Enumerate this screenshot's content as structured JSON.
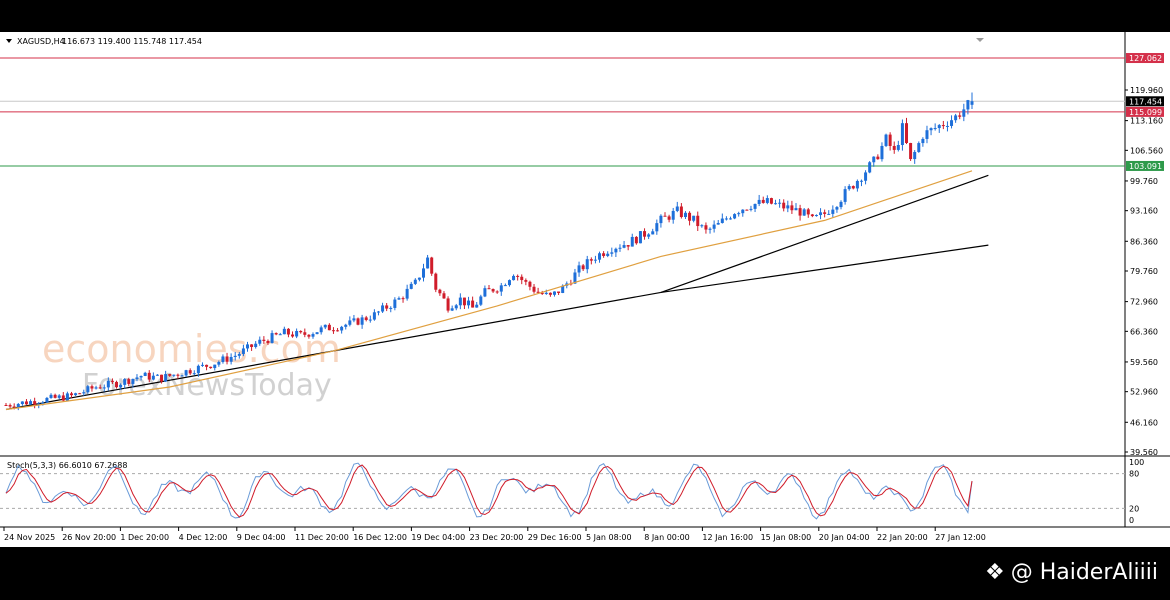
{
  "header": {
    "symbol": "XAGUSD,H4",
    "ohlc": "116.673 119.400 115.748 117.454",
    "dropdown_icon": "triangle-down-icon"
  },
  "watermark": {
    "line1": "economies.com",
    "line2": "ForexNewsToday",
    "handle": "@ HaiderAliiii",
    "handle_icon": "diamond-logo-icon"
  },
  "colors": {
    "bull": "#1e6fd9",
    "bear": "#d01c2a",
    "resistance": "#d4304a",
    "support": "#2e9a4a",
    "ma": "#e0a040",
    "trend": "#000000",
    "stoch_main": "#6a9bd8",
    "stoch_signal": "#d01c2a"
  },
  "chart_data": {
    "type": "candlestick",
    "symbol": "XAGUSD",
    "timeframe": "H4",
    "open": 116.673,
    "high": 119.4,
    "low": 115.748,
    "close": 117.454,
    "ylim": [
      39.56,
      130.5
    ],
    "price_ticks": [
      "119.960",
      "113.160",
      "106.560",
      "99.760",
      "93.160",
      "86.360",
      "79.760",
      "72.960",
      "66.360",
      "59.560",
      "52.960",
      "46.160",
      "39.560"
    ],
    "price_tick_values": [
      119.96,
      113.16,
      106.56,
      99.76,
      93.16,
      86.36,
      79.76,
      72.96,
      66.36,
      59.56,
      52.96,
      46.16,
      39.56
    ],
    "time_ticks": [
      "24 Nov 2025",
      "26 Nov 20:00",
      "1 Dec 20:00",
      "4 Dec 12:00",
      "9 Dec 04:00",
      "11 Dec 20:00",
      "16 Dec 12:00",
      "19 Dec 04:00",
      "23 Dec 20:00",
      "29 Dec 16:00",
      "5 Jan 08:00",
      "8 Jan 00:00",
      "12 Jan 16:00",
      "15 Jan 08:00",
      "20 Jan 04:00",
      "22 Jan 20:00",
      "27 Jan 12:00"
    ],
    "hlines": [
      {
        "name": "resistance-1",
        "value": 127.062,
        "label": "127.062",
        "color": "#d4304a"
      },
      {
        "name": "resistance-2",
        "value": 115.099,
        "label": "115.099",
        "color": "#d4304a"
      },
      {
        "name": "current-price",
        "value": 117.454,
        "label": "117.454",
        "color": "#000000"
      },
      {
        "name": "support-1",
        "value": 103.091,
        "label": "103.091",
        "color": "#2e9a4a"
      }
    ],
    "close_path": [
      [
        0,
        50.0
      ],
      [
        8,
        51.0
      ],
      [
        16,
        52.0
      ],
      [
        22,
        54.0
      ],
      [
        28,
        55.0
      ],
      [
        33,
        56.5
      ],
      [
        38,
        56.0
      ],
      [
        44,
        57.5
      ],
      [
        50,
        59.0
      ],
      [
        56,
        61.0
      ],
      [
        62,
        64.0
      ],
      [
        68,
        66.0
      ],
      [
        72,
        65.5
      ],
      [
        78,
        67.0
      ],
      [
        84,
        68.0
      ],
      [
        90,
        70.0
      ],
      [
        96,
        73.5
      ],
      [
        100,
        77.0
      ],
      [
        103,
        82.5
      ],
      [
        105,
        76.0
      ],
      [
        108,
        72.0
      ],
      [
        111,
        73.5
      ],
      [
        114,
        71.5
      ],
      [
        117,
        75.0
      ],
      [
        121,
        76.5
      ],
      [
        124,
        79.5
      ],
      [
        127,
        77.0
      ],
      [
        130,
        75.0
      ],
      [
        133,
        74.0
      ],
      [
        136,
        76.0
      ],
      [
        140,
        80.0
      ],
      [
        144,
        83.0
      ],
      [
        148,
        85.0
      ],
      [
        152,
        86.0
      ],
      [
        156,
        88.0
      ],
      [
        160,
        91.0
      ],
      [
        164,
        93.0
      ],
      [
        168,
        91.0
      ],
      [
        171,
        88.5
      ],
      [
        174,
        90.0
      ],
      [
        178,
        93.0
      ],
      [
        182,
        94.5
      ],
      [
        186,
        95.0
      ],
      [
        190,
        94.0
      ],
      [
        194,
        93.0
      ],
      [
        197,
        91.0
      ],
      [
        200,
        92.5
      ],
      [
        204,
        96.0
      ],
      [
        208,
        100.0
      ],
      [
        212,
        104.0
      ],
      [
        215,
        109.0
      ],
      [
        217,
        106.0
      ],
      [
        219,
        111.5
      ],
      [
        221,
        104.0
      ],
      [
        224,
        110.0
      ],
      [
        228,
        112.0
      ],
      [
        232,
        114.0
      ],
      [
        236,
        117.454
      ]
    ],
    "ma_path": [
      [
        0,
        49.0
      ],
      [
        40,
        54.0
      ],
      [
        80,
        62.0
      ],
      [
        120,
        72.0
      ],
      [
        160,
        83.0
      ],
      [
        200,
        91.0
      ],
      [
        236,
        102.0
      ]
    ],
    "trendlines": [
      {
        "name": "trendline-1",
        "from": [
          0,
          49.0
        ],
        "to": [
          160,
          75.0
        ]
      },
      {
        "name": "trendline-2",
        "from": [
          160,
          75.0
        ],
        "to": [
          240,
          101.0
        ]
      },
      {
        "name": "trendline-3",
        "from": [
          160,
          75.0
        ],
        "to": [
          240,
          85.5
        ]
      }
    ],
    "stochastic": {
      "label": "Stoch(5,3,3) 66.6010 67.2688",
      "main": 66.601,
      "signal": 67.2688,
      "levels": [
        80,
        20
      ],
      "ticks": [
        "100",
        "80",
        "20",
        "0"
      ],
      "tick_values": [
        100,
        80,
        20,
        0
      ]
    }
  }
}
